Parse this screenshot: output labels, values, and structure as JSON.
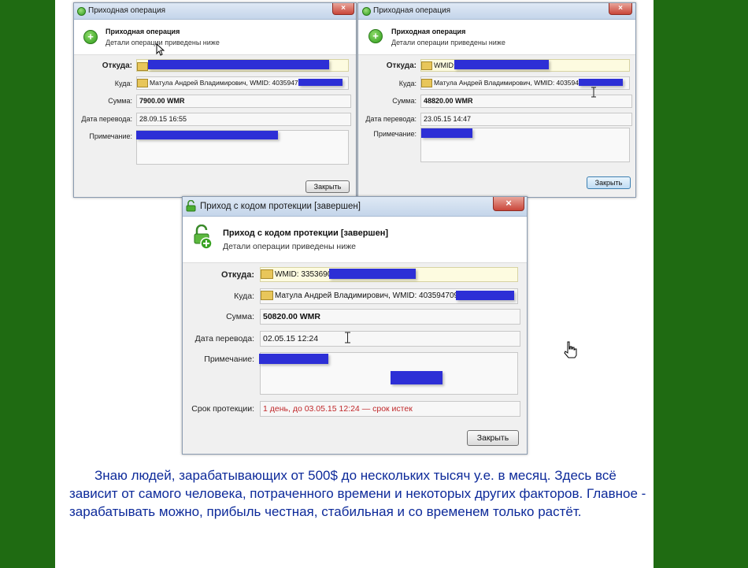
{
  "window1": {
    "title": "Приходная операция",
    "header_title": "Приходная операция",
    "header_sub": "Детали операции приведены ниже",
    "from_label": "Откуда:",
    "to_label": "Куда:",
    "to_value": "Матула Андрей Владимирович, WMID: 403594709",
    "sum_label": "Сумма:",
    "sum_value": "7900.00 WMR",
    "date_label": "Дата перевода:",
    "date_value": "28.09.15 16:55",
    "note_label": "Примечание:",
    "close_label": "Закрыть"
  },
  "window2": {
    "title": "Приходная операция",
    "header_title": "Приходная операция",
    "header_sub": "Детали операции приведены ниже",
    "from_label": "Откуда:",
    "from_value": "WMID:",
    "to_label": "Куда:",
    "to_value": "Матула Андрей Владимирович, WMID: 403594709",
    "sum_label": "Сумма:",
    "sum_value": "48820.00 WMR",
    "date_label": "Дата перевода:",
    "date_value": "23.05.15 14:47",
    "note_label": "Примечание:",
    "close_label": "Закрыть"
  },
  "window3": {
    "title": "Приход с кодом протекции [завершен]",
    "header_title": "Приход с кодом протекции [завершен]",
    "header_sub": "Детали операции приведены ниже",
    "from_label": "Откуда:",
    "from_value": "WMID: 3353690",
    "to_label": "Куда:",
    "to_value": "Матула Андрей Владимирович, WMID: 403594709",
    "sum_label": "Сумма:",
    "sum_value": "50820.00 WMR",
    "date_label": "Дата перевода:",
    "date_value": "02.05.15 12:24",
    "note_label": "Примечание:",
    "protect_label": "Срок протекции:",
    "protect_value": "1 день, до 03.05.15 12:24 — срок истек",
    "close_label": "Закрыть"
  },
  "icons": {
    "close": "×",
    "add": "+"
  },
  "colors": {
    "background": "#1f6b12",
    "body_text": "#0d2a9a",
    "redaction": "#2d2fd6",
    "protection_text": "#c0282a"
  },
  "body_text": {
    "para1": "Знаю людей, зарабатывающих от 500$ до нескольких тысяч у.е. в месяц. Здесь всё зависит от самого человека, потраченного времени и некоторых других факторов. Главное - зарабатывать можно, прибыль честная, стабильная и со временем только растёт."
  }
}
